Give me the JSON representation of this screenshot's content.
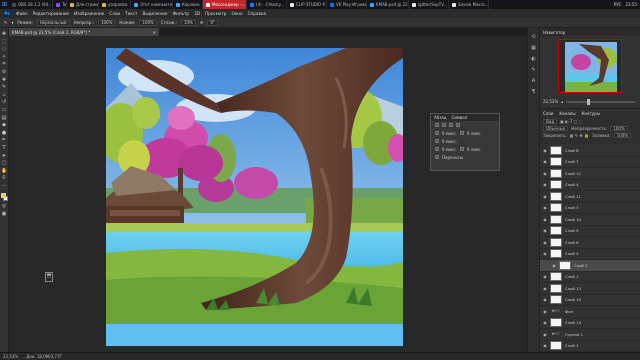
{
  "taskbar": {
    "tabs": [
      {
        "label": "OBS 28.1.2 (64-...",
        "color": "#4a4a4a"
      },
      {
        "label": "Tw",
        "color": "#9146ff"
      },
      {
        "label": "Для стримов",
        "color": "#e3b341"
      },
      {
        "label": "yaspanbo",
        "color": "#e3b341"
      },
      {
        "label": "Этот компьюте...",
        "color": "#4aa3ff"
      },
      {
        "label": "Корзина",
        "color": "#4aa3ff"
      },
      {
        "label": "Мессенджер -...",
        "color": "#ffffff"
      },
      {
        "label": "(4) - Chlamy...",
        "color": "#0a84ff"
      },
      {
        "label": "CLIP STUDIO P...",
        "color": "#e8e8e8"
      },
      {
        "label": "VK Play Игрово...",
        "color": "#0077ff"
      },
      {
        "label": "KMAB.psd @ 22...",
        "color": "#31a8ff"
      },
      {
        "label": "lgitter/SvpTV...",
        "color": "#e8e8e8"
      },
      {
        "label": "Savoie Macro...",
        "color": "#e8e8e8"
      }
    ],
    "lang": "РУС",
    "time": "23:55"
  },
  "menubar": {
    "logo": "Ps",
    "items": [
      "Файл",
      "Редактирование",
      "Изображение",
      "Слои",
      "Текст",
      "Выделение",
      "Фильтр",
      "3D",
      "Просмотр",
      "Окно",
      "Справка"
    ]
  },
  "optionsbar": {
    "mode_label": "Режим:",
    "mode_value": "Нормальный",
    "opacity_label": "Непрозр.:",
    "opacity_value": "100%",
    "flow_label": "Нажим:",
    "flow_value": "100%",
    "smooth_label": "Сглаж.:",
    "smooth_value": "10%",
    "angle_value": "0°"
  },
  "document_tab": "KMAB.psd @ 22,5% (Слой 2, RGB/8*) *",
  "float_panel": {
    "tabs": [
      "Абзац",
      "Символ"
    ],
    "rows": [
      {
        "left": "0 пикс.",
        "right": "0 пикс."
      },
      {
        "left": "0 пикс.",
        "right": ""
      },
      {
        "left": "0 пикс.",
        "right": "0 пикс."
      }
    ],
    "hyphen_label": "Переносы"
  },
  "navigator": {
    "title": "Навигатор",
    "zoom": "22,53%"
  },
  "layers_panel": {
    "tabs": [
      "Слои",
      "Каналы",
      "Контуры"
    ],
    "kind_label": "Вид",
    "blend": "Обычные",
    "opacity_label": "Непрозрачность:",
    "opacity": "100%",
    "lock_label": "Закрепить:",
    "fill_label": "Заливка:",
    "fill": "100%"
  },
  "layers": [
    {
      "name": "Слой 8",
      "kind": "light",
      "selected": false,
      "clip": false
    },
    {
      "name": "Слой 7",
      "kind": "light",
      "selected": false,
      "clip": false
    },
    {
      "name": "Слой 12",
      "kind": "light",
      "selected": false,
      "clip": false
    },
    {
      "name": "Слой 4",
      "kind": "light",
      "selected": false,
      "clip": false
    },
    {
      "name": "Слой 11",
      "kind": "light",
      "selected": false,
      "clip": false
    },
    {
      "name": "Слой 3",
      "kind": "light",
      "selected": false,
      "clip": false
    },
    {
      "name": "Слой 10",
      "kind": "light",
      "selected": false,
      "clip": false
    },
    {
      "name": "Слой 9",
      "kind": "light",
      "selected": false,
      "clip": false
    },
    {
      "name": "Слой 6",
      "kind": "light",
      "selected": false,
      "clip": false
    },
    {
      "name": "Слой 5",
      "kind": "light",
      "selected": false,
      "clip": false
    },
    {
      "name": "Слой 2",
      "kind": "light",
      "selected": true,
      "clip": true
    },
    {
      "name": "Слой 1",
      "kind": "light",
      "selected": false,
      "clip": false
    },
    {
      "name": "Слой 13",
      "kind": "light",
      "selected": false,
      "clip": false
    },
    {
      "name": "Слой 15",
      "kind": "light",
      "selected": false,
      "clip": false
    },
    {
      "name": "Фон",
      "kind": "folder",
      "selected": false,
      "clip": false
    },
    {
      "name": "Слой 14",
      "kind": "light",
      "selected": false,
      "clip": false
    },
    {
      "name": "Группа 1",
      "kind": "folder",
      "selected": false,
      "clip": false
    },
    {
      "name": "Слой 1",
      "kind": "light",
      "selected": false,
      "clip": false
    }
  ],
  "statusbar": {
    "zoom": "22,53%",
    "doc": "Док: 18,0M/3,77Г"
  }
}
